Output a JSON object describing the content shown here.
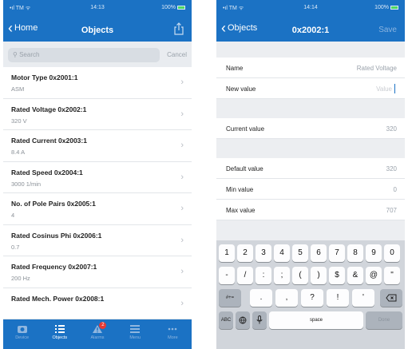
{
  "left": {
    "status": {
      "carrier": "•ıl TM ᯤ",
      "time": "14:13",
      "battery": "100%"
    },
    "nav": {
      "back": "Home",
      "title": "Objects"
    },
    "search": {
      "placeholder": "Search",
      "cancel": "Cancel"
    },
    "items": [
      {
        "title": "Motor Type  0x2001:1",
        "value": "ASM"
      },
      {
        "title": "Rated Voltage  0x2002:1",
        "value": "320  V"
      },
      {
        "title": "Rated Current  0x2003:1",
        "value": "8.4  A"
      },
      {
        "title": "Rated Speed  0x2004:1",
        "value": "3000  1/min"
      },
      {
        "title": "No. of Pole Pairs  0x2005:1",
        "value": "4"
      },
      {
        "title": "Rated Cosinus Phi  0x2006:1",
        "value": "0.7"
      },
      {
        "title": "Rated Frequency  0x2007:1",
        "value": "200  Hz"
      },
      {
        "title": "Rated Mech. Power  0x2008:1",
        "value": ""
      }
    ],
    "tabs": [
      {
        "label": "Device"
      },
      {
        "label": "Objects"
      },
      {
        "label": "Alarms",
        "badge": "2"
      },
      {
        "label": "Menu"
      },
      {
        "label": "More"
      }
    ]
  },
  "right": {
    "status": {
      "carrier": "•ıl TM ᯤ",
      "time": "14:14",
      "battery": "100%"
    },
    "nav": {
      "back": "Objects",
      "title": "0x2002:1",
      "action": "Save"
    },
    "name_label": "Name",
    "name_value": "Rated Voltage",
    "new_label": "New value",
    "new_placeholder": "Value",
    "current_label": "Current value",
    "current_value": "320",
    "default_label": "Default value",
    "default_value": "320",
    "min_label": "Min value",
    "min_value": "0",
    "max_label": "Max value",
    "max_value": "707",
    "keyboard": {
      "row1": [
        "1",
        "2",
        "3",
        "4",
        "5",
        "6",
        "7",
        "8",
        "9",
        "0"
      ],
      "row2": [
        "-",
        "/",
        ":",
        ";",
        "(",
        ")",
        "$",
        "&",
        "@",
        "\""
      ],
      "row3_left": "#+=",
      "row3": [
        ".",
        ",",
        "?",
        "!",
        "'"
      ],
      "abc": "ABC",
      "space": "space",
      "done": "Done"
    }
  }
}
